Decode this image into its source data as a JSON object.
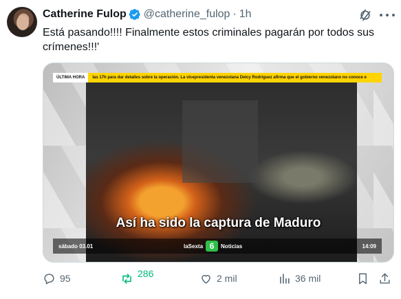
{
  "author": {
    "display_name": "Catherine Fulop",
    "handle": "@catherine_fulop",
    "separator": "·",
    "time_ago": "1h"
  },
  "tweet": {
    "text": "Está pasando!!!! Finalmente estos criminales pagarán por todos sus crímenes!!!'"
  },
  "media": {
    "tag": "ÚLTIMA HORA",
    "ticker": "las 17h para dar detalles sobre la operación.       La vicepresidenta venezolana Delcy Rodríguez afirma que el gobierno venezolano no conoce e",
    "caption": "Así ha sido la captura de Maduro",
    "date": "sábado 03.01",
    "channel_name": "laSexta",
    "channel_logo": "6",
    "channel_section": "Noticias",
    "clock": "14:09"
  },
  "actions": {
    "replies": "95",
    "reposts": "286",
    "likes": "2 mil",
    "views": "36 mil"
  },
  "icons": [
    "verified-badge-icon",
    "grok-icon",
    "more-icon",
    "reply-icon",
    "repost-icon",
    "like-icon",
    "views-icon",
    "bookmark-icon",
    "share-icon"
  ],
  "colors": {
    "text": "#0f1419",
    "secondary": "#536471",
    "verified": "#1d9bf0",
    "repost_active": "#00ba7c",
    "news_bar": "#ffd400",
    "channel_logo": "#2fbf4a"
  }
}
